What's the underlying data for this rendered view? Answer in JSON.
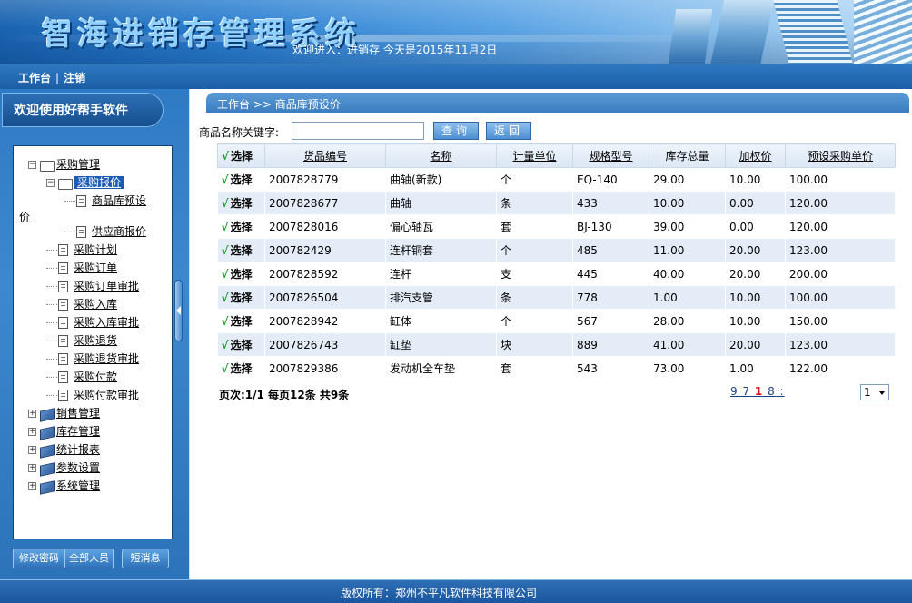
{
  "header": {
    "app_title": "智海进销存管理系统",
    "welcome": "欢迎进入：进销存 今天是2015年11月2日"
  },
  "topnav": {
    "workbench": "工作台",
    "separator": "|",
    "logout": "注销"
  },
  "sidebar": {
    "title": "欢迎使用好帮手软件",
    "tree": {
      "purchase_mgmt": "采购管理",
      "purchase_quote": "采购报价",
      "stock_preset_price_a": "商品库预设",
      "stock_preset_price_b": "价",
      "supplier_quote": "供应商报价",
      "purchase_plan": "采购计划",
      "purchase_order": "采购订单",
      "purchase_order_review": "采购订单审批",
      "purchase_in": "采购入库",
      "purchase_in_review": "采购入库审批",
      "purchase_return": "采购退货",
      "purchase_return_review": "采购退货审批",
      "purchase_payment": "采购付款",
      "purchase_payment_review": "采购付款审批",
      "sales_mgmt": "销售管理",
      "inventory_mgmt": "库存管理",
      "stat_reports": "统计报表",
      "param_settings": "参数设置",
      "system_mgmt": "系统管理"
    },
    "buttons": {
      "change_password": "修改密码",
      "all_staff": "全部人员",
      "short_message": "短消息"
    }
  },
  "main": {
    "breadcrumb": "工作台 >> 商品库预设价",
    "search": {
      "label": "商品名称关键字:",
      "value": "",
      "query_button": "查询",
      "back_button": "返回"
    },
    "table": {
      "check_mark": "√",
      "headers": [
        "选择",
        "货品编号",
        "名称",
        "计量单位",
        "规格型号",
        "库存总量",
        "加权价",
        "预设采购单价"
      ],
      "rows": [
        {
          "select": "选择",
          "code": "2007828779",
          "name": "曲轴(新款)",
          "unit": "个",
          "spec": "EQ-140",
          "stock": "29.00",
          "wavg": "10.00",
          "preset": "100.00"
        },
        {
          "select": "选择",
          "code": "2007828677",
          "name": "曲轴",
          "unit": "条",
          "spec": "433",
          "stock": "10.00",
          "wavg": "0.00",
          "preset": "120.00"
        },
        {
          "select": "选择",
          "code": "2007828016",
          "name": "偏心轴瓦",
          "unit": "套",
          "spec": "BJ-130",
          "stock": "39.00",
          "wavg": "0.00",
          "preset": "120.00"
        },
        {
          "select": "选择",
          "code": "200782429",
          "name": "连杆铜套",
          "unit": "个",
          "spec": "485",
          "stock": "11.00",
          "wavg": "20.00",
          "preset": "123.00"
        },
        {
          "select": "选择",
          "code": "2007828592",
          "name": "连杆",
          "unit": "支",
          "spec": "445",
          "stock": "40.00",
          "wavg": "20.00",
          "preset": "200.00"
        },
        {
          "select": "选择",
          "code": "2007826504",
          "name": "排汽支管",
          "unit": "条",
          "spec": "778",
          "stock": "1.00",
          "wavg": "10.00",
          "preset": "100.00"
        },
        {
          "select": "选择",
          "code": "2007828942",
          "name": "缸体",
          "unit": "个",
          "spec": "567",
          "stock": "28.00",
          "wavg": "10.00",
          "preset": "150.00"
        },
        {
          "select": "选择",
          "code": "2007826743",
          "name": "缸垫",
          "unit": "块",
          "spec": "889",
          "stock": "41.00",
          "wavg": "20.00",
          "preset": "123.00"
        },
        {
          "select": "选择",
          "code": "2007829386",
          "name": "发动机全车垫",
          "unit": "套",
          "spec": "543",
          "stock": "73.00",
          "wavg": "1.00",
          "preset": "122.00"
        }
      ]
    },
    "pager": {
      "summary": "页次:1/1 每页12条 共9条",
      "nav_prefix": "9 7 ",
      "nav_current": "1",
      "nav_suffix": " 8 :",
      "selected_page": "1"
    }
  },
  "footer": {
    "copyright": "版权所有：郑州不平凡软件科技有限公司"
  }
}
